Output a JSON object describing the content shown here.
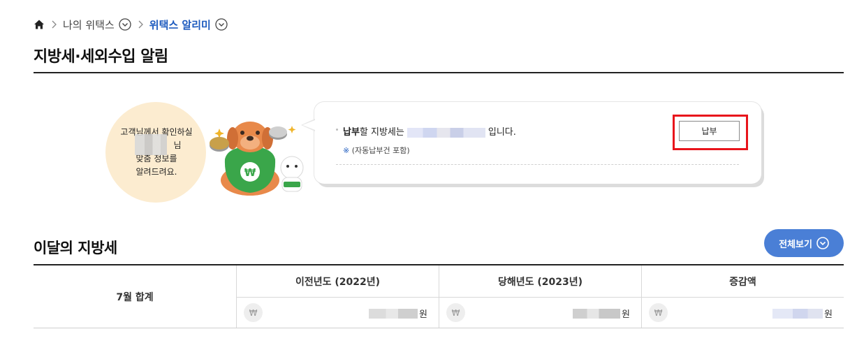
{
  "breadcrumb": {
    "home_icon": "home-icon",
    "level1": "나의 위택스",
    "level2": "위택스 알리미"
  },
  "page": {
    "title": "지방세·세외수입 알림"
  },
  "greeting": {
    "line1": "고객님께서 확인하실",
    "line2": "님",
    "line3": "맞춤 정보를",
    "line4": "알려드려요."
  },
  "notice": {
    "pay_word": "납부",
    "text_before": "할 지방세는",
    "text_after": "입니다.",
    "sub_mark": "※",
    "sub_text": "(자동납부건 포함)",
    "pay_button": "납부"
  },
  "section": {
    "title": "이달의 지방세",
    "view_all": "전체보기"
  },
  "table": {
    "row_label": "7월 합계",
    "currency_symbol": "₩",
    "unit": "원",
    "columns": [
      {
        "header": "이전년도 (2022년)"
      },
      {
        "header": "당해년도 (2023년)"
      },
      {
        "header": "증감액"
      }
    ]
  },
  "colors": {
    "accent_blue": "#1d5bbf",
    "button_blue": "#4a7fd6",
    "highlight_red": "#e8141b",
    "bubble_peach": "#fcecd0"
  }
}
